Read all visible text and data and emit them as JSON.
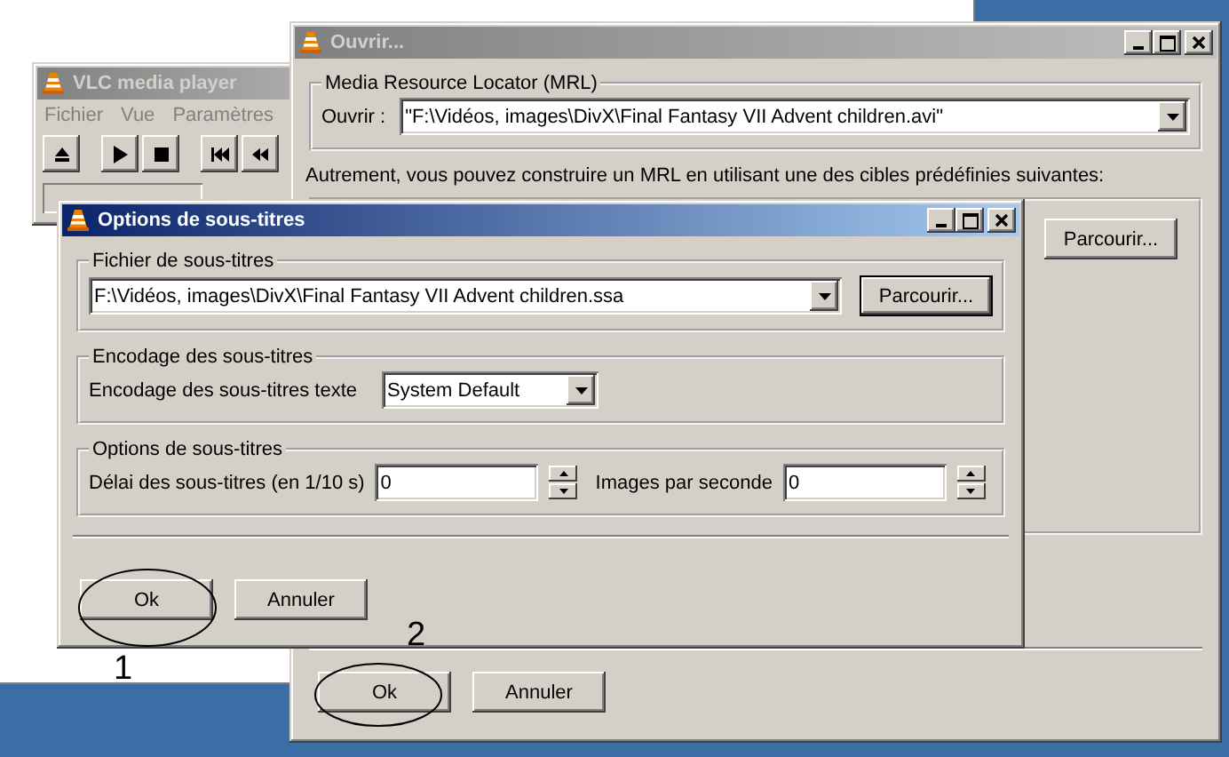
{
  "vlc_window": {
    "title": "VLC media player",
    "active": false,
    "menu": [
      "Fichier",
      "Vue",
      "Paramètres"
    ]
  },
  "open_dialog": {
    "title": "Ouvrir...",
    "active": false,
    "mrl_group": {
      "title": "Media Resource Locator (MRL)",
      "label": "Ouvrir :",
      "value": "\"F:\\Vidéos, images\\DivX\\Final Fantasy VII Advent children.avi\""
    },
    "hint": "Autrement, vous pouvez construire un MRL en utilisant une des cibles prédéfinies suivantes:",
    "browse_button": "Parcourir...",
    "buttons": [
      "Ok",
      "Annuler"
    ]
  },
  "subtitle_dialog": {
    "title": "Options de sous-titres",
    "active": true,
    "file_group": {
      "title": "Fichier de sous-titres",
      "value": "F:\\Vidéos, images\\DivX\\Final Fantasy VII Advent children.ssa",
      "browse_button": "Parcourir..."
    },
    "encoding_group": {
      "title": "Encodage des sous-titres",
      "label": "Encodage des sous-titres texte",
      "value": "System Default"
    },
    "options_group": {
      "title": "Options de sous-titres",
      "fields": [
        {
          "label": "Délai des sous-titres (en 1/10 s)",
          "value": "0"
        },
        {
          "label": "Images par seconde",
          "value": "0"
        }
      ]
    },
    "buttons": [
      "Ok",
      "Annuler"
    ]
  },
  "annotations": [
    {
      "label": "1"
    },
    {
      "label": "2"
    }
  ]
}
